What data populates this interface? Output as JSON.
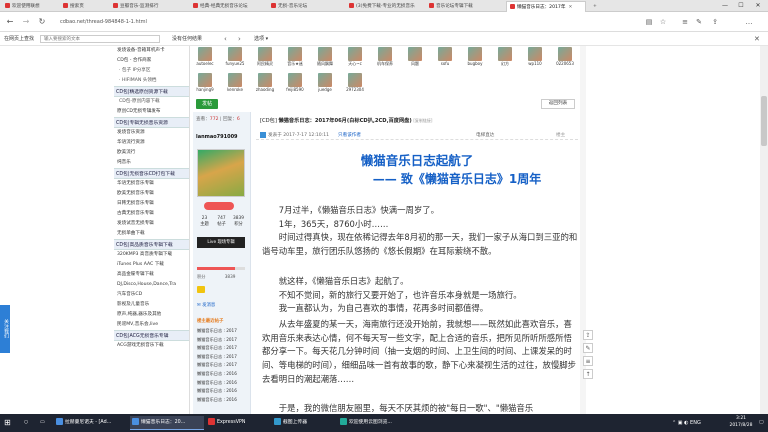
{
  "browser": {
    "tabs": [
      {
        "label": "欢迎使用联想"
      },
      {
        "label": "搜索页"
      },
      {
        "label": "豆瓣音乐-监测排行"
      },
      {
        "label": "经典-经典无损音乐论坛"
      },
      {
        "label": "无损-音乐论坛"
      },
      {
        "label": "(3)免费下载-专业的无损音乐"
      },
      {
        "label": "音乐论坛专辑下载"
      },
      {
        "label": "懒猫音乐日志：2017年"
      }
    ],
    "url": "cdbao.net/thread-984848-1-1.html",
    "window_controls": {
      "minimize": "—",
      "maximize": "☐",
      "close": "✕"
    }
  },
  "favbar": {
    "search_label": "在网页上查找",
    "search_placeholder": "输入要搜索的文本",
    "no_result": "没有任何结果",
    "options": "选项 ▾"
  },
  "sidebar": {
    "sections": [
      {
        "type": "item",
        "label": "发烧设备-音箱耳机声卡"
      },
      {
        "type": "item",
        "label": "CD包 - 合作商家"
      },
      {
        "type": "sub",
        "label": "· 包子 IP分享区"
      },
      {
        "type": "sub",
        "label": "· HIFIMAN 头领档"
      },
      {
        "type": "header",
        "label": "CD包|精选原创资源下载"
      },
      {
        "type": "sub",
        "label": "CD包-原创内容下载"
      },
      {
        "type": "item",
        "label": "原创CD无损专辑发布"
      },
      {
        "type": "header",
        "label": "CD包|专辑无损音乐资源"
      },
      {
        "type": "item",
        "label": "发烧音乐资源"
      },
      {
        "type": "item",
        "label": "华语流行资源"
      },
      {
        "type": "item",
        "label": "欧美流行"
      },
      {
        "type": "item",
        "label": "纯音乐"
      },
      {
        "type": "header",
        "label": "CD包|无损音乐CD打包下载"
      },
      {
        "type": "item",
        "label": "华语无损音乐专辑"
      },
      {
        "type": "item",
        "label": "欧美无损音乐专辑"
      },
      {
        "type": "item",
        "label": "日韩无损音乐专辑"
      },
      {
        "type": "item",
        "label": "古典无损音乐专辑"
      },
      {
        "type": "item",
        "label": "发烧试音无损专辑"
      },
      {
        "type": "item",
        "label": "无损单曲下载"
      },
      {
        "type": "header",
        "label": "CD包|高品质音乐专辑下载"
      },
      {
        "type": "item",
        "label": "320KMP3 高音质专辑下载"
      },
      {
        "type": "item",
        "label": "iTunes Plus AAC 下载"
      },
      {
        "type": "item",
        "label": "高品金碟专辑下载"
      },
      {
        "type": "item",
        "label": "DJ,Disco,House,Dance,Tra"
      },
      {
        "type": "item",
        "label": "汽车音乐CD"
      },
      {
        "type": "item",
        "label": "影视及儿童音乐"
      },
      {
        "type": "item",
        "label": "原声,纯器,器乐及其他"
      },
      {
        "type": "item",
        "label": "民谣MV,音乐会,live"
      },
      {
        "type": "header",
        "label": "CD包|ACG无损音乐专辑"
      },
      {
        "type": "item",
        "label": "ACG游戏无损音乐下载"
      }
    ]
  },
  "avatars": [
    {
      "name": "autoelec"
    },
    {
      "name": "funyue25"
    },
    {
      "name": "阿民精灵"
    },
    {
      "name": "音乐★迷"
    },
    {
      "name": "随风飘舞"
    },
    {
      "name": "天心~c"
    },
    {
      "name": "机车保养"
    },
    {
      "name": "风题"
    },
    {
      "name": "sofu"
    },
    {
      "name": "bugboy"
    },
    {
      "name": "幻方"
    },
    {
      "name": "wp110"
    },
    {
      "name": "0220653"
    },
    {
      "name": "hanjing9"
    },
    {
      "name": "kenroke"
    },
    {
      "name": "zhaoding"
    },
    {
      "name": "feiji8590"
    },
    {
      "name": "juedge"
    },
    {
      "name": "2972304"
    }
  ],
  "actions": {
    "post": "发帖",
    "back_list": "返回列表"
  },
  "userpanel": {
    "view_label": "查看：",
    "view_count": "772",
    "reply_label": "回复：",
    "reply_count": "6",
    "username": "lanmao791009",
    "stats": [
      {
        "value": "23",
        "label": "主题"
      },
      {
        "value": "747",
        "label": "帖子"
      },
      {
        "value": "3839",
        "label": "积分"
      }
    ],
    "badge": "Live 现场专辑",
    "level_label": "积分",
    "level_value": "3839",
    "send_msg": "发消息",
    "recent_title": "楼主最近帖子",
    "recent_posts": [
      "懒猫音乐日志 : 2017",
      "懒猫音乐日志 : 2017",
      "懒猫音乐日志 : 2017",
      "懒猫音乐日志 : 2017",
      "懒猫音乐日志 : 2017",
      "懒猫音乐日志 : 2016",
      "懒猫音乐日志 : 2016",
      "懒猫音乐日志 : 2016",
      "懒猫音乐日志 : 2016"
    ]
  },
  "thread": {
    "prefix": "[CD包]",
    "title": "懒猫音乐日志：2017年06月(白标CD扒,2CD,百度网盘)",
    "tag": "[复制链接]",
    "meta_icon": "楼主",
    "author": "发表于 2017-7-17 12:10:11",
    "only_author": "只看该作者",
    "floor": "电梯直达",
    "floor_label": "楼主",
    "article_title1": "懒猫音乐日志起航了",
    "article_title2": "—— 致《懒猫音乐日志》1周年",
    "paragraphs": [
      "　　7月过半，《懒猫音乐日志》快满一周岁了。\n　　1年，365天，8760小时……\n　　时间过得真快，现在依稀记得去年8月初的那一天，我们一家子从海口到三亚的和谐号动车里，旅行团乐队悠扬的《悠长假期》在耳际萦绕不散。",
      "　　就这样，《懒猫音乐日志》起航了。\n　　不知不觉间，新的旅行又要开始了，也许音乐本身就是一场旅行。\n　　我一直都认为，为自己喜欢的事情，花再多时间都值得。",
      "　　从去年盛夏的某一天，海南旅行还没开始前，我就想——既然如此喜欢音乐，喜欢用音乐来表达心情，何不每天写一些文字，配上合适的音乐，把所见所听所感所悟都分享一下。每天花几分钟时间（抽一支烟的时间、上卫生间的时间、上课发呆的时间、等电梯的时间），细细品味一首有故事的歌，静下心来凝视生活的过往，放慢脚步去看明日的潮起潮落……",
      "　　于是，我的微信朋友圈里，每天不厌其烦的被\"每日一歌\"、\"懒猫音乐"
    ]
  },
  "left_tab": "关注我们",
  "taskbar": {
    "items": [
      {
        "label": "拉赫曼尼诺夫 - [Ad..."
      },
      {
        "label": "懒猫音乐日志：20..."
      },
      {
        "label": "ExpressVPN"
      },
      {
        "label": "截图上传器"
      },
      {
        "label": "欢迎使用云图浏览..."
      }
    ],
    "tray": "ENG",
    "time": "3:21",
    "date": "2017/8/28"
  },
  "colors": {
    "title_blue": "#1560c6",
    "post_green": "#2a9a3a",
    "taskbar": "#1e2431"
  }
}
